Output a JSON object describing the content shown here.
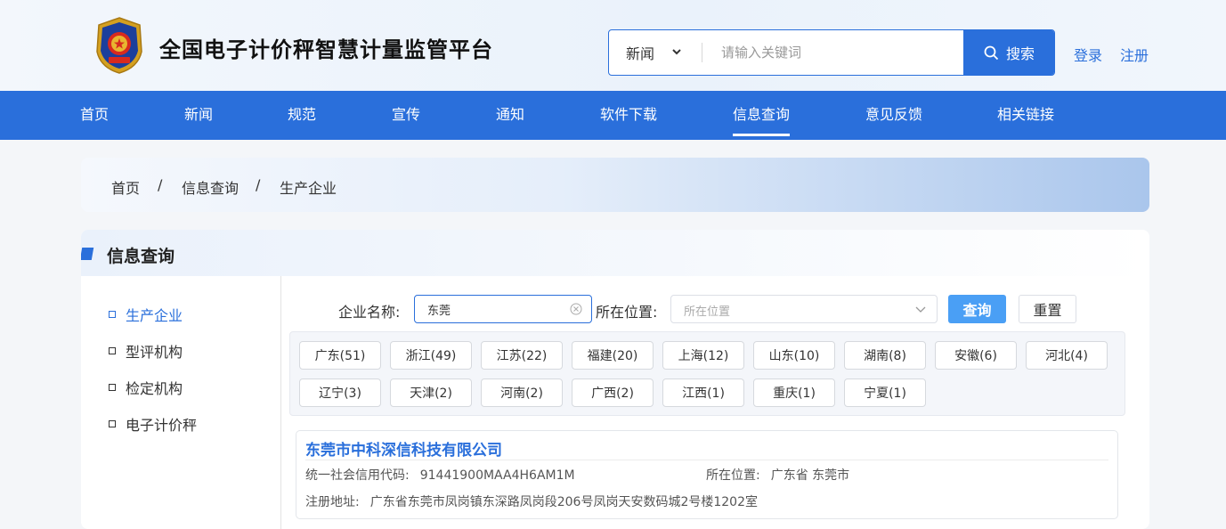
{
  "header": {
    "site_title": "全国电子计价秤智慧计量监管平台",
    "search": {
      "category": "新闻",
      "placeholder": "请输入关键词",
      "button_label": "搜索"
    },
    "login": "登录",
    "register": "注册"
  },
  "nav": {
    "items": [
      "首页",
      "新闻",
      "规范",
      "宣传",
      "通知",
      "软件下载",
      "信息查询",
      "意见反馈",
      "相关链接"
    ],
    "active": "信息查询"
  },
  "breadcrumb": {
    "items": [
      "首页",
      "信息查询",
      "生产企业"
    ],
    "separator": "/"
  },
  "panel": {
    "title": "信息查询",
    "sidebar": [
      "生产企业",
      "型评机构",
      "检定机构",
      "电子计价秤"
    ],
    "sidebar_active": "生产企业"
  },
  "filter": {
    "name_label": "企业名称:",
    "name_value": "东莞",
    "location_label": "所在位置:",
    "location_placeholder": "所在位置",
    "query_button": "查询",
    "reset_button": "重置"
  },
  "provinces": [
    "广东(51)",
    "浙江(49)",
    "江苏(22)",
    "福建(20)",
    "上海(12)",
    "山东(10)",
    "湖南(8)",
    "安徽(6)",
    "河北(4)",
    "辽宁(3)",
    "天津(2)",
    "河南(2)",
    "广西(2)",
    "江西(1)",
    "重庆(1)",
    "宁夏(1)"
  ],
  "result": {
    "company": "东莞市中科深信科技有限公司",
    "credit_label": "统一社会信用代码:",
    "credit_value": "91441900MAA4H6AM1M",
    "location_label": "所在位置:",
    "location_value": "广东省 东莞市",
    "address_label": "注册地址:",
    "address_value": "广东省东莞市凤岗镇东深路凤岗段206号凤岗天安数码城2号楼1202室"
  },
  "colors": {
    "primary": "#2a6fdb",
    "query_button": "#4a9ff5"
  }
}
